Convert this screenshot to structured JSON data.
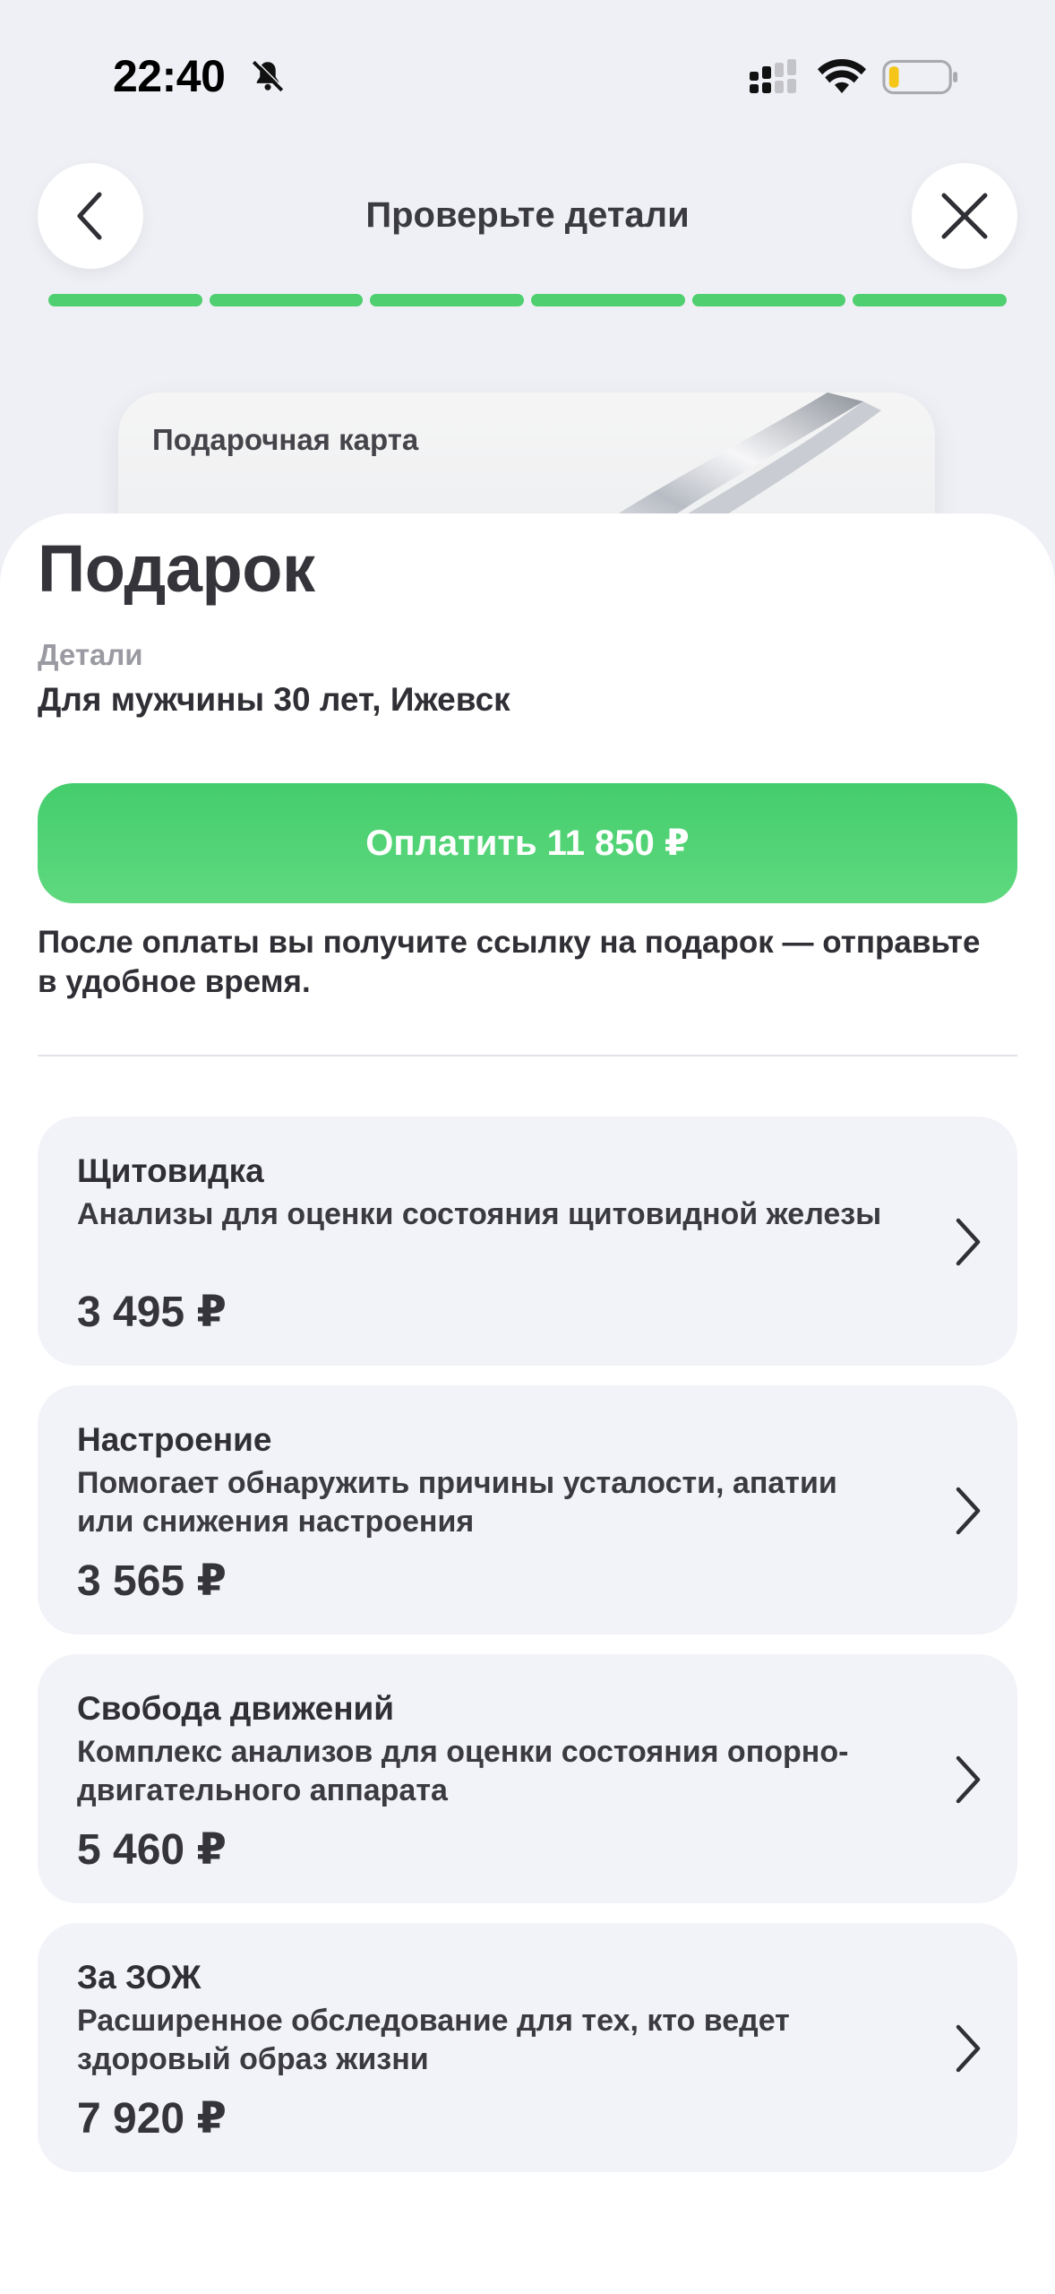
{
  "status_bar": {
    "time": "22:40",
    "icons": [
      "bell-muted-icon",
      "cellular-signal-icon",
      "wifi-icon",
      "battery-low-icon"
    ]
  },
  "header": {
    "title": "Проверьте детали",
    "back_icon": "chevron-left-icon",
    "close_icon": "close-icon"
  },
  "progress": {
    "steps_total": 6,
    "steps_completed": 6,
    "color": "#4fcf6f"
  },
  "gift_card": {
    "label": "Подарочная карта"
  },
  "sheet": {
    "title": "Подарок",
    "details_label": "Детали",
    "details_value": "Для мужчины 30 лет, Ижевск",
    "pay_button_label": "Оплатить 11 850 ₽",
    "pay_note": "После оплаты вы получите ссылку на подарок — отправьте в удобное время."
  },
  "offers": [
    {
      "title": "Щитовидка",
      "description": "Анализы для оценки состояния щитовидной железы",
      "price": "3 495 ₽"
    },
    {
      "title": "Настроение",
      "description": "Помогает обнаружить  причины усталости, апатии или снижения настроения",
      "price": "3 565 ₽"
    },
    {
      "title": "Свобода движений",
      "description": "Комплекс анализов для оценки состояния опорно-двигательного аппарата",
      "price": "5 460 ₽"
    },
    {
      "title": "За ЗОЖ",
      "description": "Расширенное обследование для тех, кто ведет здоровый образ жизни",
      "price": "7 920 ₽"
    }
  ],
  "colors": {
    "accent": "#4fcf6f",
    "background": "#eef0f5",
    "card": "#f2f3f8",
    "text": "#2f2f35",
    "muted": "#9a9aa2"
  }
}
